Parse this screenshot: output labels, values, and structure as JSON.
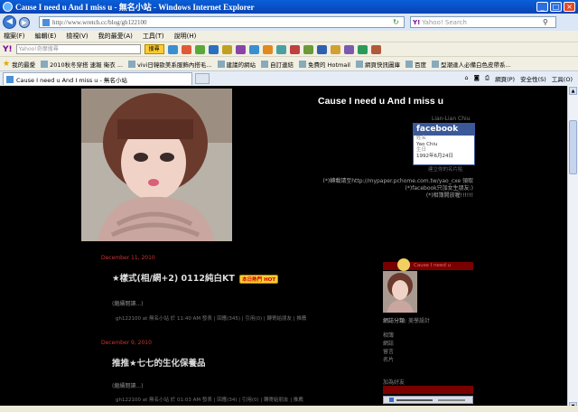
{
  "window": {
    "title": "Cause I need u And I miss u - 無名小站 - Windows Internet Explorer"
  },
  "address_bar": {
    "url": "http://www.wretch.cc/blog/gh122100",
    "search_placeholder": "Yahoo! Search"
  },
  "menu": [
    "檔案(F)",
    "編輯(E)",
    "檢視(V)",
    "我的最愛(A)",
    "工具(T)",
    "說明(H)"
  ],
  "yahoo_toolbar": {
    "logo": "Y!",
    "input_placeholder": "Yahoo!奇摩搜尋",
    "search_label": "搜尋"
  },
  "favorites_bar": {
    "favorites_label": "我的最愛",
    "items": [
      "2010秋冬穿搭 速報 衛衣 ...",
      "vivi日韓歐美系服飾內搭毛...",
      "建議的網站",
      "自訂連結",
      "免費的 Hotmail",
      "網頁快訊圖庫",
      "百度",
      "型潮達人必備白色皮帶系..."
    ]
  },
  "tab": {
    "label": "Cause I need u And I miss u - 無名小站",
    "tools": [
      "網頁(P)",
      "安全性(S)",
      "工具(O)"
    ]
  },
  "blog": {
    "title": "Cause I need u And I miss u",
    "fb_name": "Lian-Lian Chiu",
    "fb": {
      "brand": "facebook",
      "name_label": "姓名",
      "name_value": "Yao Chiu",
      "birthday_label": "生日",
      "birthday_value": "1992年6月24日",
      "link": "建立你的名片貼"
    },
    "notes": [
      "(*)轉載請至http://mypaper.pchome.com.tw/yao_cxe 領取",
      "(*)facebook只加女生朋友:)",
      "(*)相簿開放喔!!!!!!"
    ],
    "posts": [
      {
        "date": "December 11, 2010",
        "title": "★樣式(相/網+2) 0112純白KT",
        "badge": "本日熱門 HOT",
        "more": "(繼續閱讀...)",
        "meta": "gh122100 at 無名小站 於 11:40 AM 發表 | 回應(345) | 引用(0) | 轉寄給朋友 | 推薦"
      },
      {
        "date": "December 9, 2010",
        "title": "推推★七七的生化保養品",
        "badge": "",
        "more": "(繼續閱讀...)",
        "meta": "gh122100 at 無名小站 於 01:03 AM 發表 | 回應(34) | 引用(0) | 轉寄給朋友 | 推薦"
      }
    ],
    "sidebar": {
      "header": "Cause I need u",
      "category_label": "網誌分類:",
      "category_value": "美學設計",
      "links": [
        "相簿",
        "網誌",
        "留言",
        "名片"
      ],
      "friends_label": "加為好友"
    }
  }
}
